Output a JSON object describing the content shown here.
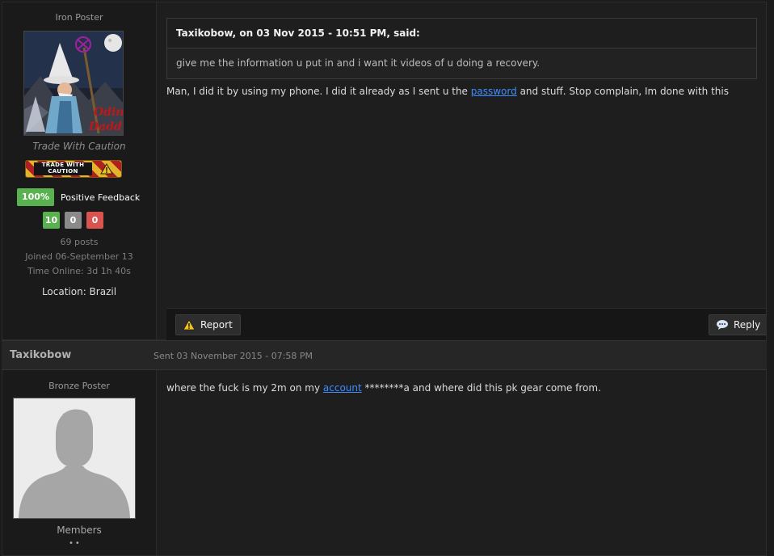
{
  "post1": {
    "rank": "Iron Poster",
    "status_text": "Trade With Caution",
    "badge_text": "TRADE WITH CAUTION",
    "feedback": {
      "percent": "100%",
      "label": "Positive Feedback",
      "positive": "10",
      "neutral": "0",
      "negative": "0"
    },
    "posts": "69 posts",
    "joined": "Joined 06-September 13",
    "time_online": "Time Online: 3d 1h 40s",
    "location": "Location: Brazil",
    "quote_header": "Taxikobow, on 03 Nov 2015 - 10:51 PM, said:",
    "quote_body": "give me the information u put in and i want it videos of u doing a recovery.",
    "body_before": "Man, I did it by using my phone. I did it already as I sent u the ",
    "body_link": "password",
    "body_after": " and stuff. Stop complain, Im done with this",
    "report_label": "Report",
    "reply_label": "Reply"
  },
  "post2": {
    "author": "Taxikobow",
    "sent": "Sent 03 November 2015 - 07:58 PM",
    "rank": "Bronze Poster",
    "group": "Members",
    "body_before": "where the fuck is my 2m on my ",
    "body_link": "account",
    "body_after": " ********a and where did this pk gear come from."
  },
  "colors": {
    "page_bg": "#1b1b1b",
    "link": "#3d8dff",
    "positive": "#5ab14f",
    "neutral": "#8a8a8a",
    "negative": "#d9534f"
  },
  "icons": [
    "warning-icon",
    "reply-bubble-icon",
    "default-avatar-icon",
    "wizard-avatar-image"
  ]
}
